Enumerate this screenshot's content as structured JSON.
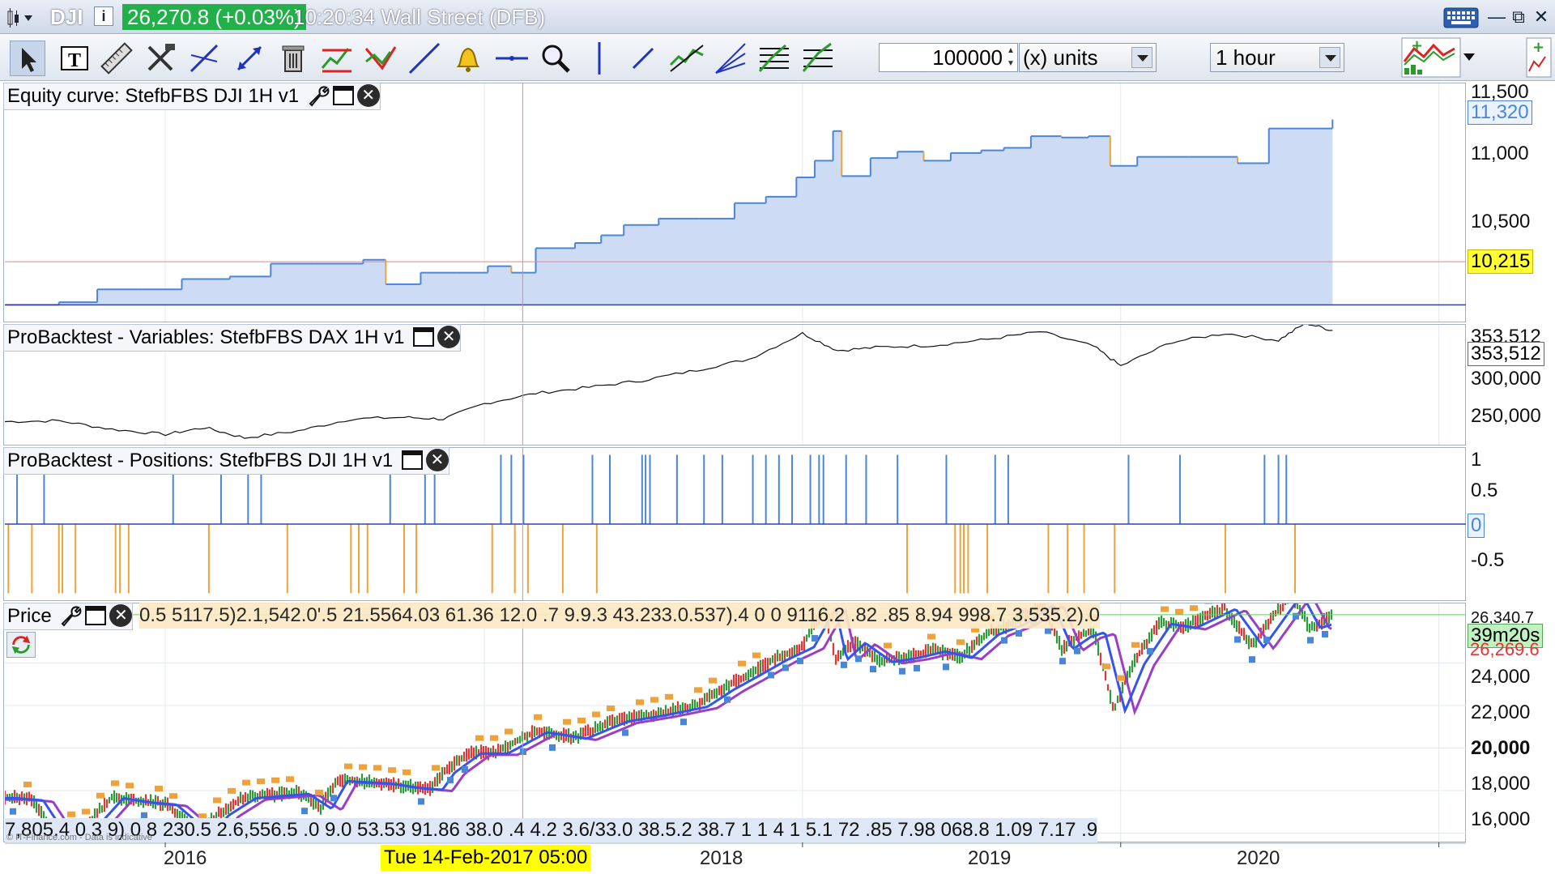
{
  "titlebar": {
    "symbol": "DJI",
    "info_icon": "i",
    "price": "26,270.8 (+0.03%)",
    "time_market": "10:20:34 Wall Street (DFB)",
    "keyboard_icon": "keyboard-icon",
    "minimize": "—",
    "restore": "⧉",
    "close": "✕"
  },
  "toolbar": {
    "tools": [
      "pointer-icon",
      "text-icon",
      "ruler-icon",
      "tools-icon",
      "trendline-icon",
      "arrow-icon",
      "trash-icon",
      "channel-icon",
      "triangle-icon",
      "line-icon",
      "alert-bell-icon",
      "horizontal-line-icon",
      "zoom-icon",
      "vertical-line-icon",
      "segment-icon",
      "zigzag-icon",
      "fan-icon",
      "fibonacci-icon",
      "fibonacci-extension-icon"
    ],
    "quantity": "100000",
    "units_label": "(x) units",
    "timeframe": "1 hour",
    "indicators_icon": "add-indicator-icon"
  },
  "colors": {
    "equity_line": "#4a86d6",
    "equity_fill": "#cddcf4",
    "equity_orange": "#f0a23a",
    "positions_long": "#4a86d6",
    "positions_short": "#f0a23a",
    "crosshair": "#ef8080",
    "price_up": "#2c9a3a",
    "price_down": "#e23535",
    "ma_blue": "#3355ee",
    "ma_purple": "#9a3ec8"
  },
  "panels": {
    "equity": {
      "title": "Equity curve: StefbFBS DJI 1H v1",
      "y_ticks": [
        "11,500",
        "11,000",
        "10,500"
      ],
      "last_value": "11,320",
      "cross_value": "10,215"
    },
    "variables": {
      "title": "ProBacktest - Variables: StefbFBS DAX 1H v1",
      "y_ticks": [
        "353,512",
        "300,000",
        "250,000"
      ],
      "last_value": "353,512"
    },
    "positions": {
      "title": "ProBacktest - Positions: StefbFBS DJI 1H v1",
      "y_ticks": [
        "1",
        "0.5",
        "-0.5"
      ],
      "zero_value": "0"
    },
    "price": {
      "title": "Price",
      "y_ticks": [
        "26,340.7",
        "24,000",
        "22,000",
        "20,000",
        "18,000",
        "16,000"
      ],
      "countdown": "39m20s",
      "last_value": "26,269.6",
      "ohlc_text": "0.5 5117.5)2.1,542.0'.5 21.5564.03 61.36 12.0 .7 9.9.3 43.233.0.537).4 0 0 9116.2 .82 .85 8.94 998.7 3.535.2).0",
      "bottom_text": "7,805.4 0 3 9) 0 8 230.5 2.6,556.5 .0 9.0 53.53 91.86 38.0 .4 4.2 3.6/33.0 38.5.2 38.7 1 1 4 1 5.1 72 .85 7.98 068.8 1.09 7.17 .9",
      "watermark": "© IT-Finance.com - Data is indicative"
    }
  },
  "x_axis": {
    "ticks": [
      "2016",
      "2018",
      "2019",
      "2020"
    ],
    "crosshair_date": "Tue 14-Feb-2017 05:00"
  },
  "chart_data": [
    {
      "type": "area",
      "name": "equity",
      "title": "Equity curve: StefbFBS DJI 1H v1",
      "x_range": [
        "2015-07-01",
        "2020-02-01"
      ],
      "ylim": [
        9750,
        11600
      ],
      "x": [
        "2015-07-02",
        "2015-09-01",
        "2015-10-15",
        "2015-12-01",
        "2016-01-20",
        "2016-03-15",
        "2016-05-01",
        "2016-06-20",
        "2016-08-15",
        "2016-09-10",
        "2016-10-20",
        "2016-12-01",
        "2017-01-05",
        "2017-02-01",
        "2017-03-01",
        "2017-04-15",
        "2017-05-15",
        "2017-06-10",
        "2017-07-20",
        "2017-09-05",
        "2017-10-15",
        "2017-11-20",
        "2017-12-25",
        "2018-01-15",
        "2018-02-05",
        "2018-02-15",
        "2018-03-20",
        "2018-04-20",
        "2018-05-20",
        "2018-06-20",
        "2018-07-25",
        "2018-08-20",
        "2018-09-20",
        "2018-10-25",
        "2018-11-25",
        "2018-12-20",
        "2019-01-20",
        "2019-02-20",
        "2019-03-20",
        "2019-05-15",
        "2019-06-20",
        "2019-07-20",
        "2019-09-01"
      ],
      "values": [
        9880,
        9900,
        10000,
        10000,
        10080,
        10100,
        10200,
        10200,
        10230,
        10040,
        10130,
        10130,
        10180,
        10130,
        10320,
        10360,
        10420,
        10500,
        10550,
        10550,
        10670,
        10720,
        10870,
        11000,
        11230,
        10880,
        11020,
        11070,
        11000,
        11060,
        11080,
        11100,
        11190,
        11180,
        11190,
        10960,
        11030,
        11030,
        11030,
        10980,
        11250,
        11250,
        11320
      ]
    },
    {
      "type": "line",
      "name": "variables",
      "title": "ProBacktest - Variables: StefbFBS DAX 1H v1",
      "ylim": [
        220000,
        360000
      ],
      "x": [
        "2015-07-01",
        "2015-09-01",
        "2015-11-01",
        "2016-01-01",
        "2016-02-15",
        "2016-04-01",
        "2016-06-01",
        "2016-08-01",
        "2016-10-01",
        "2016-11-15",
        "2017-01-01",
        "2017-03-01",
        "2017-05-01",
        "2017-07-01",
        "2017-09-01",
        "2017-11-01",
        "2018-01-01",
        "2018-02-10",
        "2018-04-01",
        "2018-06-01",
        "2018-08-01",
        "2018-10-01",
        "2018-12-01",
        "2019-01-01",
        "2019-03-01",
        "2019-05-01",
        "2019-07-01",
        "2019-08-01",
        "2019-09-01"
      ],
      "values": [
        247000,
        248000,
        238000,
        232000,
        240000,
        228000,
        236000,
        250000,
        252000,
        250000,
        268000,
        280000,
        287000,
        295000,
        307000,
        320000,
        350000,
        330000,
        334000,
        336000,
        343000,
        352000,
        335000,
        312000,
        340000,
        350000,
        342000,
        362000,
        353512
      ]
    },
    {
      "type": "bar",
      "name": "positions",
      "title": "ProBacktest - Positions: StefbFBS DJI 1H v1",
      "ylim": [
        -1.1,
        1.1
      ],
      "long_x": [
        "2015-07-15",
        "2015-08-15",
        "2016-01-10",
        "2016-03-05",
        "2016-04-05",
        "2016-04-20",
        "2016-09-15",
        "2016-10-25",
        "2016-11-05",
        "2017-01-20",
        "2017-02-01",
        "2017-02-15",
        "2017-05-05",
        "2017-05-25",
        "2017-07-01",
        "2017-07-05",
        "2017-07-10",
        "2017-08-10",
        "2017-09-10",
        "2017-10-01",
        "2017-11-05",
        "2017-11-20",
        "2017-12-05",
        "2017-12-20",
        "2018-01-10",
        "2018-01-20",
        "2018-01-25",
        "2018-02-20",
        "2018-03-15",
        "2018-04-20",
        "2018-06-15",
        "2018-08-10",
        "2018-08-25",
        "2019-01-10",
        "2019-03-10",
        "2019-06-15",
        "2019-07-01",
        "2019-07-10"
      ],
      "long_values": [
        1,
        0.85,
        1,
        1,
        1,
        1,
        1,
        1,
        1,
        1,
        1,
        1,
        1,
        1,
        1,
        1,
        1,
        1,
        1,
        1,
        1,
        1,
        1,
        1,
        1,
        1,
        1,
        1,
        1,
        1,
        1,
        1,
        1,
        1,
        1,
        1,
        1,
        1
      ],
      "short_x": [
        "2015-07-05",
        "2015-08-01",
        "2015-09-01",
        "2015-09-05",
        "2015-09-20",
        "2015-11-05",
        "2015-11-10",
        "2015-11-20",
        "2016-02-20",
        "2016-05-20",
        "2016-08-01",
        "2016-08-10",
        "2016-08-20",
        "2016-10-01",
        "2016-10-15",
        "2017-01-10",
        "2017-02-05",
        "2017-02-20",
        "2017-04-01",
        "2017-05-10",
        "2018-05-01",
        "2018-06-25",
        "2018-07-01",
        "2018-07-05",
        "2018-07-10",
        "2018-08-01",
        "2018-10-10",
        "2018-11-01",
        "2018-11-20",
        "2018-12-25",
        "2019-05-01",
        "2019-07-20"
      ],
      "short_values": [
        -1,
        -1,
        -1,
        -1,
        -1,
        -1,
        -1,
        -1,
        -1,
        -1,
        -1,
        -1,
        -1,
        -1,
        -1,
        -1,
        -1,
        -1,
        -1,
        -1,
        -1,
        -1,
        -1,
        -1,
        -1,
        -1,
        -1,
        -1,
        -1,
        -1,
        -1,
        -1
      ]
    },
    {
      "type": "line",
      "name": "price",
      "title": "Price",
      "ylim": [
        15600,
        26800
      ],
      "x": [
        "2015-07-01",
        "2015-08-01",
        "2015-08-25",
        "2015-10-01",
        "2015-11-01",
        "2015-12-01",
        "2016-01-01",
        "2016-02-10",
        "2016-03-01",
        "2016-04-01",
        "2016-05-01",
        "2016-06-01",
        "2016-06-27",
        "2016-07-15",
        "2016-09-01",
        "2016-10-01",
        "2016-11-01",
        "2016-11-15",
        "2016-12-15",
        "2017-01-15",
        "2017-03-01",
        "2017-04-15",
        "2017-06-01",
        "2017-07-15",
        "2017-09-01",
        "2017-10-01",
        "2017-11-01",
        "2017-12-01",
        "2018-01-01",
        "2018-01-26",
        "2018-02-08",
        "2018-03-01",
        "2018-04-01",
        "2018-05-01",
        "2018-06-01",
        "2018-07-01",
        "2018-08-01",
        "2018-09-01",
        "2018-10-03",
        "2018-10-25",
        "2018-11-15",
        "2018-12-01",
        "2018-12-24",
        "2019-01-15",
        "2019-02-15",
        "2019-03-15",
        "2019-04-30",
        "2019-06-01",
        "2019-07-15",
        "2019-08-05",
        "2019-08-20",
        "2019-09-01"
      ],
      "values": [
        17700,
        17600,
        16100,
        16300,
        17700,
        17500,
        17400,
        16000,
        16900,
        17700,
        17800,
        17900,
        17200,
        18500,
        18400,
        18200,
        18100,
        18900,
        19800,
        19800,
        20800,
        20500,
        21300,
        21600,
        22000,
        22800,
        23500,
        24200,
        24800,
        26600,
        24200,
        25000,
        24100,
        24300,
        24600,
        24300,
        25400,
        25900,
        26800,
        24700,
        25300,
        25500,
        21800,
        24000,
        25900,
        25700,
        26600,
        24800,
        27300,
        25700,
        25900,
        26270
      ]
    }
  ]
}
